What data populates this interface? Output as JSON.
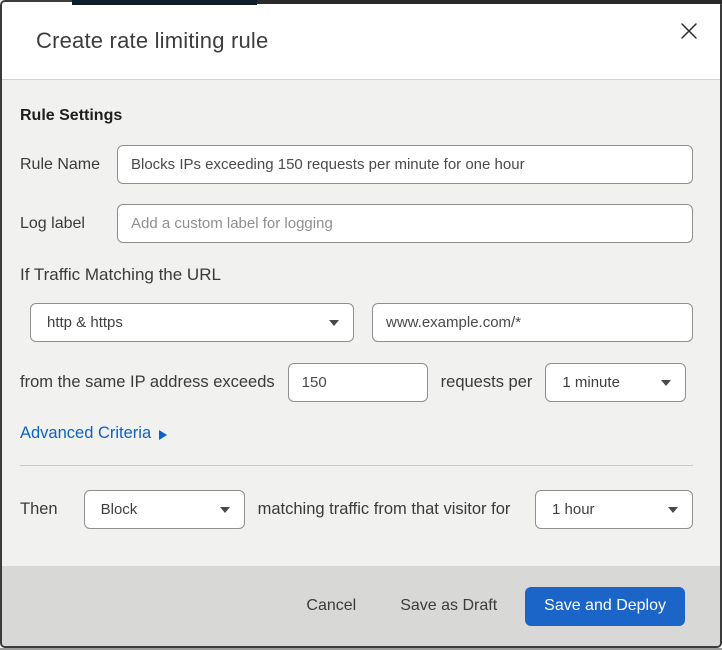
{
  "modal": {
    "title": "Create rate limiting rule"
  },
  "icons": {
    "close_icon": "✕",
    "select_caret_icon": "▼",
    "advanced_criteria_arrow_icon": "▶"
  },
  "form": {
    "section_heading": "Rule Settings",
    "rule_name": {
      "label": "Rule Name",
      "value": "Blocks IPs exceeding 150 requests per minute for one hour"
    },
    "log_label": {
      "label": "Log label",
      "placeholder": "Add a custom label for logging"
    },
    "traffic_match": {
      "heading": "If Traffic Matching the URL",
      "scheme_selected": "http & https",
      "url_value": "www.example.com/*"
    },
    "threshold": {
      "prefix": "from the same IP address exceeds",
      "requests_value": "150",
      "middle": "requests per",
      "period_selected": "1 minute"
    },
    "advanced_criteria_label": "Advanced Criteria",
    "then": {
      "label": "Then",
      "action_selected": "Block",
      "middle": "matching traffic from that visitor for",
      "duration_selected": "1 hour"
    }
  },
  "footer": {
    "cancel_label": "Cancel",
    "save_draft_label": "Save as Draft",
    "save_deploy_label": "Save and Deploy"
  },
  "colors": {
    "accent_blue": "#1b64c8",
    "link_blue": "#0d62c6",
    "content_bg": "#f1f1f0",
    "footer_bg": "#d8d8d7",
    "modal_border": "#3b3b3b",
    "top_strip_navy": "#0e1d2c",
    "top_strip_dark": "#29292c"
  }
}
